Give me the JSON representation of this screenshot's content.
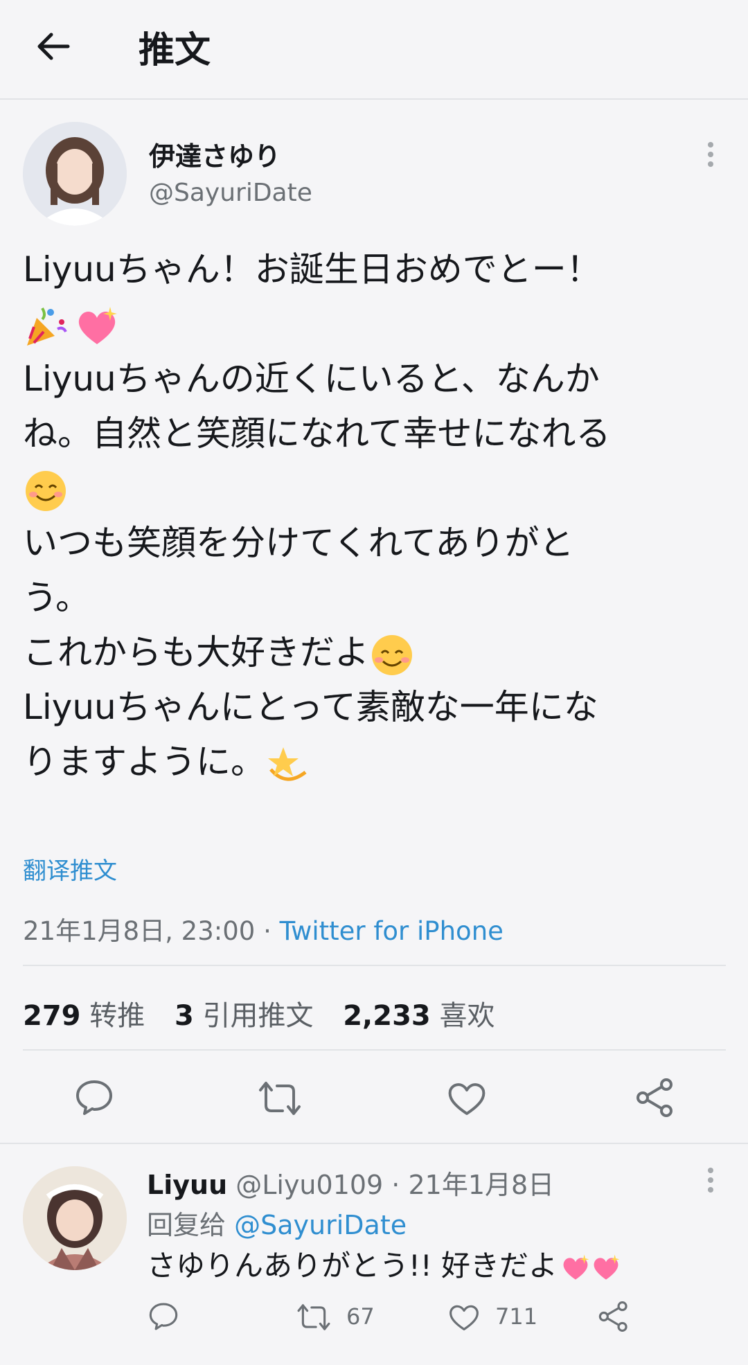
{
  "header": {
    "title": "推文"
  },
  "tweet": {
    "author_name": "伊達さゆり",
    "author_handle": "@SayuriDate",
    "lines": [
      "Liyuuちゃん！お誕生日おめでとー！",
      "",
      "Liyuuちゃんの近くにいると、なんか",
      "ね。自然と笑顔になれて幸せになれる",
      "",
      "いつも笑顔を分けてくれてありがと",
      "う。",
      "これからも大好きだよ",
      "",
      "Liyuuちゃんにとって素敵な一年にな",
      "りますように。"
    ],
    "emoji_icons": [
      "party-popper-icon",
      "sparkling-heart-icon",
      "smiling-face-icon",
      "smiling-blush-face-icon",
      "dizzy-star-icon"
    ],
    "translate_label": "翻译推文",
    "timestamp": "21年1月8日, 23:00 · ",
    "source": "Twitter for iPhone",
    "retweets_count": "279",
    "retweets_label": "转推",
    "quotes_count": "3",
    "quotes_label": "引用推文",
    "likes_count": "2,233",
    "likes_label": "喜欢"
  },
  "reply": {
    "author_name": "Liyuu",
    "author_handle": "@Liyu0109 · 21年1月8日",
    "reply_to_label": "回复给",
    "reply_to_handle": "@SayuriDate",
    "text": "さゆりんありがとう!! 好きだよ",
    "retweet_count": "67",
    "like_count": "711"
  },
  "colors": {
    "accent": "#2f8ed0",
    "heart": "#ff6fa3"
  }
}
